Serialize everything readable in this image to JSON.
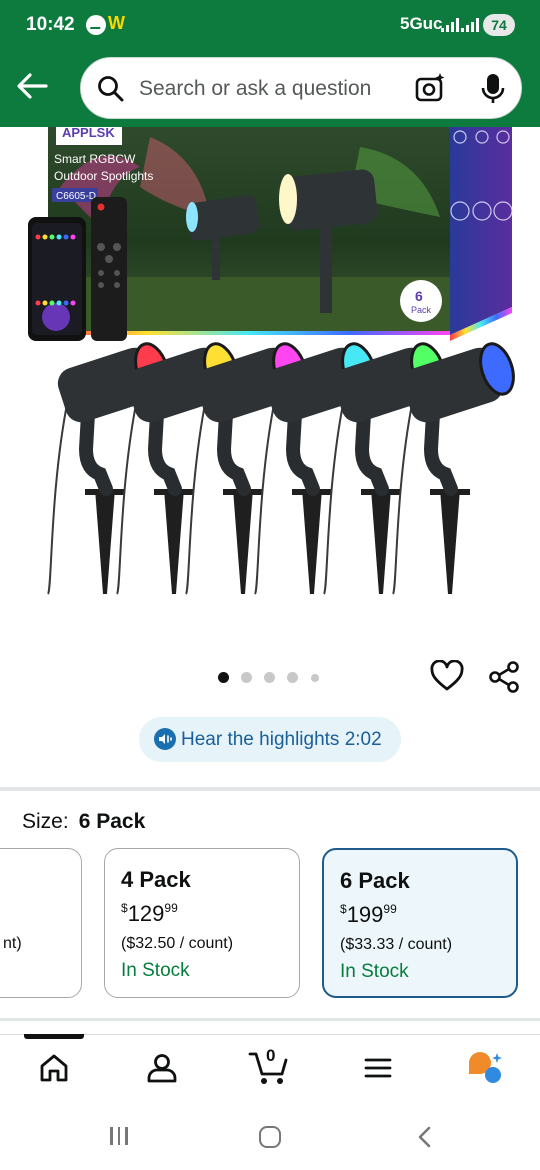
{
  "status_bar": {
    "time": "10:42",
    "network": "5Guc",
    "battery": "74",
    "app_badge": "W"
  },
  "search": {
    "placeholder": "Search or ask a question"
  },
  "product_image": {
    "box_brand": "APPLSK",
    "box_title_line1": "Smart RGBCW",
    "box_title_line2": "Outdoor Spotlights",
    "box_model": "C6605-D",
    "box_pack_number": "6",
    "box_pack_label": "Pack",
    "light_colors": [
      "#ff3b4e",
      "#ffe032",
      "#ff45f0",
      "#46e8f5",
      "#52ff64",
      "#3d6bff"
    ]
  },
  "carousel": {
    "count": 5,
    "active_index": 0
  },
  "highlights": {
    "label": "Hear the highlights 2:02"
  },
  "size": {
    "label": "Size:",
    "selected": "6 Pack",
    "options": [
      {
        "title": "",
        "price_dollars": "",
        "price_cents": "",
        "unit": "nt)",
        "stock": ""
      },
      {
        "title": "4 Pack",
        "price_dollars": "129",
        "price_cents": "99",
        "currency": "$",
        "unit": "($32.50 / count)",
        "stock": "In Stock"
      },
      {
        "title": "6 Pack",
        "price_dollars": "199",
        "price_cents": "99",
        "currency": "$",
        "unit": "($33.33 / count)",
        "stock": "In Stock"
      }
    ]
  },
  "bottom_nav": {
    "cart_count": "0",
    "items": [
      "home-icon",
      "account-icon",
      "cart-icon",
      "menu-icon",
      "rufus-icon"
    ]
  },
  "colors": {
    "header_green": "#0d7a3e",
    "selected_border": "#1e5a8a",
    "stock_green": "#067d3c",
    "highlight_blue": "#1a5f9a"
  }
}
